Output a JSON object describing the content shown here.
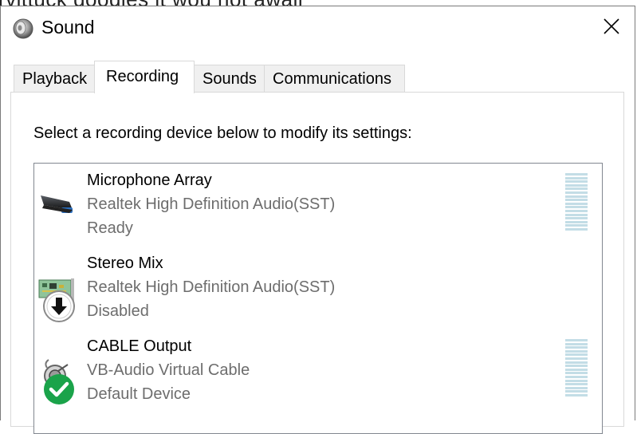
{
  "background_text": "rvittuck doodies it wou not awail",
  "window": {
    "title": "Sound",
    "close_glyph": "✕"
  },
  "tabs": [
    {
      "label": "Playback",
      "active": false
    },
    {
      "label": "Recording",
      "active": true
    },
    {
      "label": "Sounds",
      "active": false
    },
    {
      "label": "Communications",
      "active": false
    }
  ],
  "instruction": "Select a recording device below to modify its settings:",
  "devices": [
    {
      "name": "Microphone Array",
      "driver": "Realtek High Definition Audio(SST)",
      "status": "Ready",
      "icon": "microphone-array-icon",
      "level_meter": true
    },
    {
      "name": "Stereo Mix",
      "driver": "Realtek High Definition Audio(SST)",
      "status": "Disabled",
      "icon": "sound-card-icon",
      "badge": "disabled-down-arrow-icon",
      "level_meter": false
    },
    {
      "name": "CABLE Output",
      "driver": "VB-Audio Virtual Cable",
      "status": "Default Device",
      "icon": "cable-connector-icon",
      "badge": "default-checkmark-icon",
      "level_meter": true
    }
  ],
  "colors": {
    "meter": "#c3dde6",
    "default_badge": "#1aa34a",
    "secondary_text": "#6d6d6d"
  }
}
